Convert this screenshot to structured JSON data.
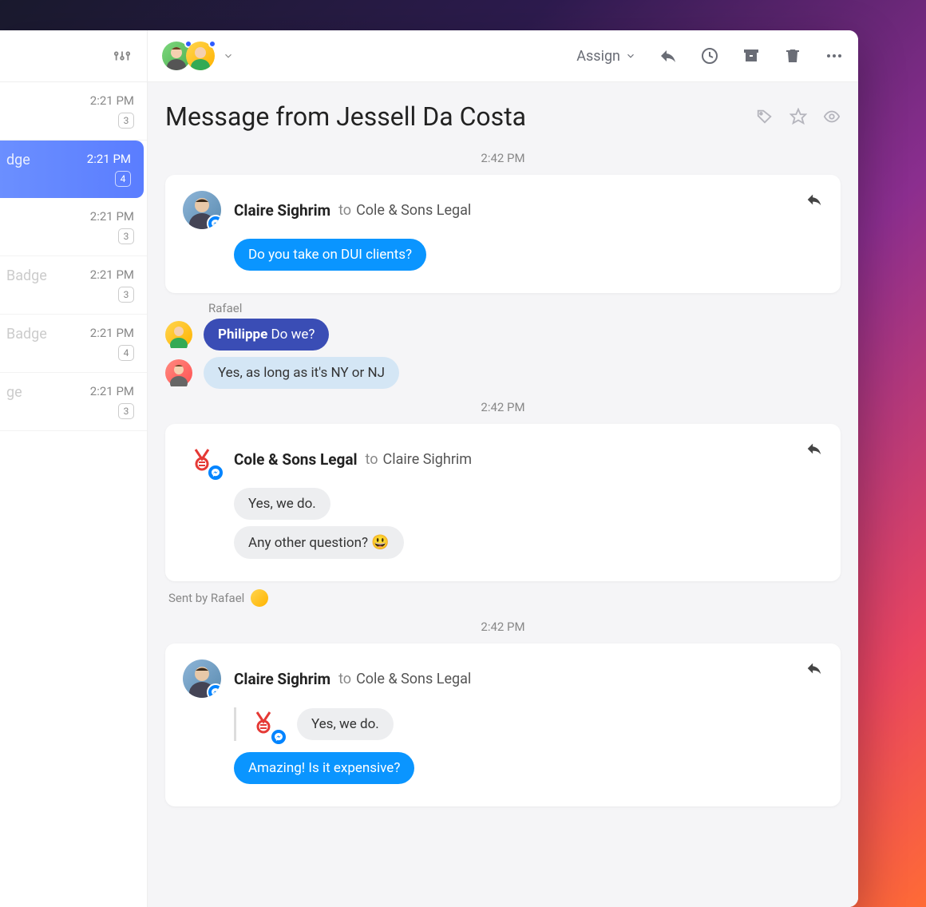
{
  "sidebar": {
    "items": [
      {
        "time": "2:21 PM",
        "count": "3",
        "label": ""
      },
      {
        "time": "2:21 PM",
        "count": "4",
        "label": "dge",
        "selected": true
      },
      {
        "time": "2:21 PM",
        "count": "3",
        "label": ""
      },
      {
        "time": "2:21 PM",
        "count": "3",
        "label": "Badge"
      },
      {
        "time": "2:21 PM",
        "count": "4",
        "label": "Badge"
      },
      {
        "time": "2:21 PM",
        "count": "3",
        "label": "ge"
      }
    ]
  },
  "topbar": {
    "assign_label": "Assign"
  },
  "page": {
    "title": "Message from Jessell Da Costa"
  },
  "timestamps": {
    "t1": "2:42 PM",
    "t2": "2:42 PM",
    "t3": "2:42 PM"
  },
  "messages": {
    "m1": {
      "from": "Claire Sighrim",
      "to_label": "to",
      "to": "Cole & Sons Legal",
      "bubble1": "Do you take on DUI clients?"
    },
    "internal": {
      "author": "Rafael",
      "mention": "Philippe",
      "text": " Do we?",
      "reply": "Yes, as long as it's NY or NJ"
    },
    "m2": {
      "from": "Cole & Sons Legal",
      "to_label": "to",
      "to": "Claire Sighrim",
      "bubble1": "Yes, we do.",
      "bubble2": "Any other question? ",
      "emoji": "😃"
    },
    "sent_by": "Sent by Rafael",
    "m3": {
      "from": "Claire Sighrim",
      "to_label": "to",
      "to": "Cole & Sons Legal",
      "quote": "Yes, we do.",
      "bubble1": "Amazing! Is it expensive?"
    }
  }
}
